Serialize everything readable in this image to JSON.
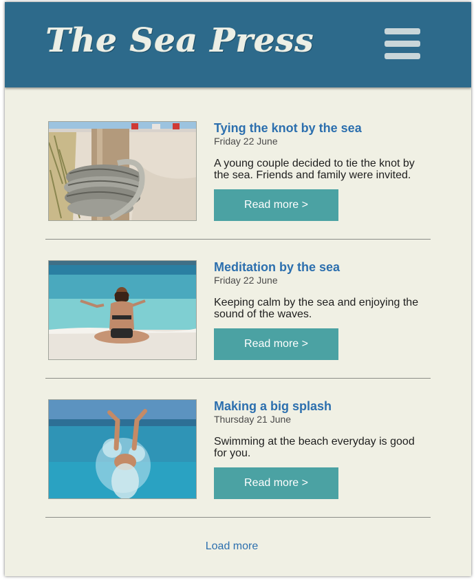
{
  "header": {
    "logo_text": "The Sea Press",
    "menu_icon": "hamburger-menu-icon",
    "background": "#2d6a8b"
  },
  "articles": [
    {
      "title": "Tying the knot by the sea",
      "date": "Friday 22 June",
      "summary": "A young couple decided to tie the knot by the sea. Friends and family were invited.",
      "button_label": "Read more >",
      "image": "rope-knot-on-post-beach-photo"
    },
    {
      "title": "Meditation by the sea",
      "date": "Friday 22 June",
      "summary": "Keeping calm by the sea and enjoying the sound of the waves.",
      "button_label": "Read more >",
      "image": "woman-meditating-on-beach-photo"
    },
    {
      "title": "Making a big splash",
      "date": "Thursday 21 June",
      "summary": "Swimming at the beach everyday is good for you.",
      "button_label": "Read more >",
      "image": "person-splashing-in-sea-photo"
    }
  ],
  "footer": {
    "load_more_label": "Load more"
  },
  "colors": {
    "page_background": "#f0f0e4",
    "accent_button": "#4ba2a3",
    "link_blue": "#2c6fae"
  }
}
